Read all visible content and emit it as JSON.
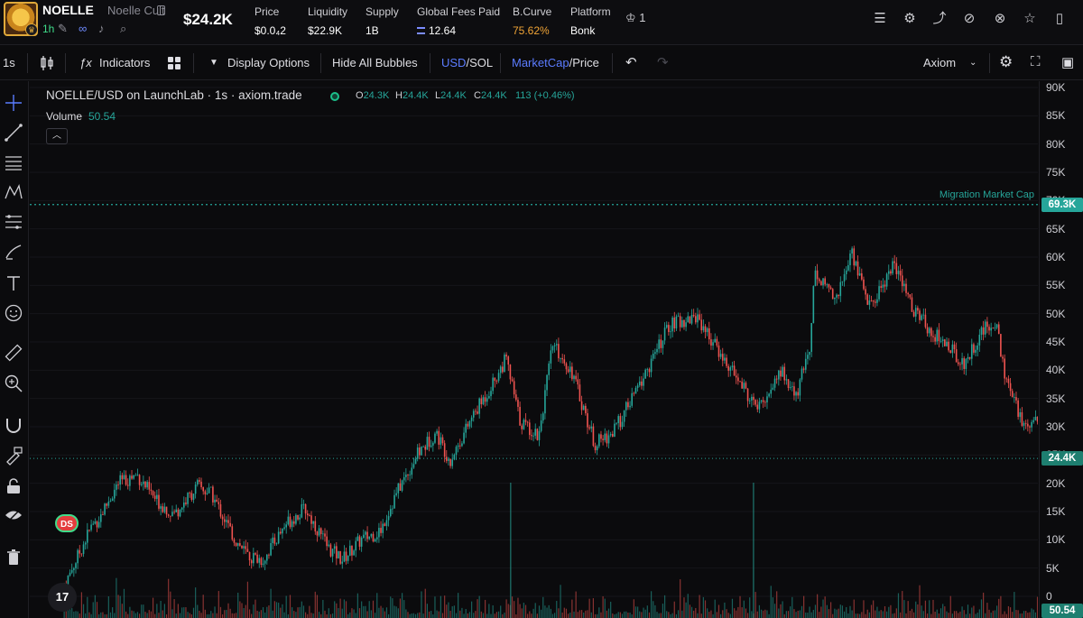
{
  "header": {
    "ticker": "NOELLE",
    "token_name": "Noelle Cult",
    "age": "1h",
    "market_cap": "$24.2K",
    "stats": [
      {
        "label": "Price",
        "value": "$0.0₄2"
      },
      {
        "label": "Liquidity",
        "value": "$22.9K"
      },
      {
        "label": "Supply",
        "value": "1B"
      },
      {
        "label": "Global Fees Paid",
        "value": "12.64"
      },
      {
        "label": "B.Curve",
        "value": "75.62%"
      },
      {
        "label": "Platform",
        "value": "Bonk"
      }
    ],
    "crown_count": "1",
    "icons": [
      "list-check-icon",
      "gear-icon",
      "share-icon",
      "eye-off-icon",
      "hide-icon",
      "star-icon",
      "bookmark-icon"
    ]
  },
  "toolbar": {
    "interval": "1s",
    "indicators": "Indicators",
    "display_options": "Display Options",
    "hide_bubbles": "Hide All Bubbles",
    "usd": "USD",
    "sol": "/SOL",
    "marketcap": "MarketCap",
    "price": "/Price",
    "source": "Axiom"
  },
  "chart": {
    "legend_title": "NOELLE/USD on LaunchLab · 1s · axiom.trade",
    "ohlc": {
      "o_label": "O",
      "o": "24.3K",
      "h_label": "H",
      "h": "24.4K",
      "l_label": "L",
      "l": "24.4K",
      "c_label": "C",
      "c": "24.4K",
      "change": "113 (+0.46%)"
    },
    "volume_label": "Volume",
    "volume_value": "50.54",
    "migration_label": "Migration Market Cap",
    "migration_value": "69.3K",
    "last_price_tag": "24.4K",
    "volume_tag": "50.54",
    "ds_badge": "DS",
    "tv_logo": "17",
    "colors": {
      "up": "#26a69a",
      "down": "#ef5350",
      "migration": "#26a69a"
    }
  },
  "chart_data": {
    "type": "candlestick",
    "y_axis_ticks": [
      "90K",
      "85K",
      "80K",
      "75K",
      "70K",
      "65K",
      "60K",
      "55K",
      "50K",
      "45K",
      "40K",
      "35K",
      "30K",
      "25K",
      "20K",
      "15K",
      "10K",
      "5K",
      "0"
    ],
    "ylim": [
      0,
      90000
    ],
    "migration_line": 69300,
    "last_price": 24400,
    "close_path": [
      [
        0,
        1000
      ],
      [
        0.03,
        12000
      ],
      [
        0.04,
        14000
      ],
      [
        0.06,
        20000
      ],
      [
        0.08,
        21500
      ],
      [
        0.1,
        17000
      ],
      [
        0.12,
        14500
      ],
      [
        0.145,
        19500
      ],
      [
        0.16,
        18000
      ],
      [
        0.185,
        10000
      ],
      [
        0.2,
        7000
      ],
      [
        0.215,
        6500
      ],
      [
        0.24,
        13000
      ],
      [
        0.26,
        15500
      ],
      [
        0.285,
        8500
      ],
      [
        0.3,
        6500
      ],
      [
        0.32,
        10000
      ],
      [
        0.34,
        11500
      ],
      [
        0.36,
        19000
      ],
      [
        0.38,
        25000
      ],
      [
        0.4,
        29000
      ],
      [
        0.415,
        24000
      ],
      [
        0.44,
        32000
      ],
      [
        0.455,
        36000
      ],
      [
        0.475,
        42000
      ],
      [
        0.49,
        31000
      ],
      [
        0.51,
        28500
      ],
      [
        0.525,
        44500
      ],
      [
        0.545,
        40000
      ],
      [
        0.57,
        27000
      ],
      [
        0.59,
        29000
      ],
      [
        0.62,
        38000
      ],
      [
        0.65,
        48000
      ],
      [
        0.68,
        49500
      ],
      [
        0.7,
        44000
      ],
      [
        0.72,
        39000
      ],
      [
        0.745,
        33000
      ],
      [
        0.77,
        40000
      ],
      [
        0.785,
        35000
      ],
      [
        0.8,
        44000
      ],
      [
        0.805,
        57000
      ],
      [
        0.83,
        53000
      ],
      [
        0.845,
        61000
      ],
      [
        0.865,
        51000
      ],
      [
        0.89,
        59000
      ],
      [
        0.91,
        51000
      ],
      [
        0.93,
        47000
      ],
      [
        0.95,
        44000
      ],
      [
        0.965,
        41000
      ],
      [
        0.985,
        47000
      ],
      [
        1.0,
        48500
      ],
      [
        1.01,
        38000
      ],
      [
        1.03,
        30000
      ],
      [
        1.05,
        33000
      ],
      [
        1.06,
        27000
      ],
      [
        1.075,
        24400
      ]
    ],
    "volume_spikes": [
      0.48,
      0.74
    ]
  }
}
